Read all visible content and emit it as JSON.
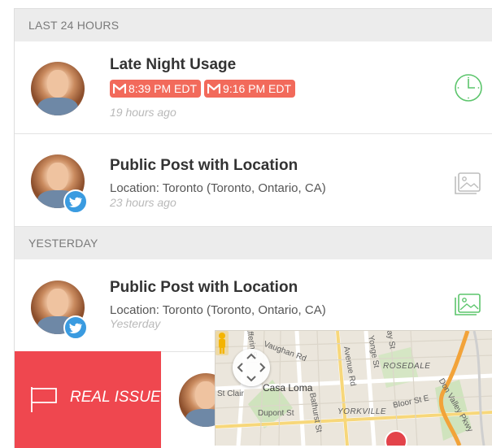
{
  "sections": [
    {
      "label": "LAST 24 HOURS"
    },
    {
      "label": "YESTERDAY"
    }
  ],
  "items": [
    {
      "title": "Late Night Usage",
      "badges": [
        "8:39 PM EDT",
        "9:16 PM EDT"
      ],
      "time": "19 hours ago",
      "icon": "clock-icon"
    },
    {
      "title": "Public Post with Location",
      "location": "Location: Toronto (Toronto, Ontario, CA)",
      "time": "23 hours ago",
      "icon": "image-icon"
    },
    {
      "title": "Public Post with Location",
      "location": "Location: Toronto (Toronto, Ontario, CA)",
      "time": "Yesterday",
      "icon": "image-icon"
    }
  ],
  "swipe": {
    "action_label": "REAL ISSUE"
  },
  "map": {
    "labels": [
      "Dufferin St",
      "Vaughan Rd",
      "Casa Loma",
      "Dupont St",
      "Bathurst St",
      "Avenue Rd",
      "Yonge St",
      "Bay St",
      "ROSEDALE",
      "YORKVILLE",
      "Bloor St E",
      "Don Valley Pkwy",
      "St Clair"
    ]
  },
  "colors": {
    "accent_red": "#ef474f",
    "badge_red": "#f26a5b",
    "icon_green": "#5cc56c",
    "icon_gray": "#bdbdbd",
    "twitter_blue": "#3a9be0"
  }
}
